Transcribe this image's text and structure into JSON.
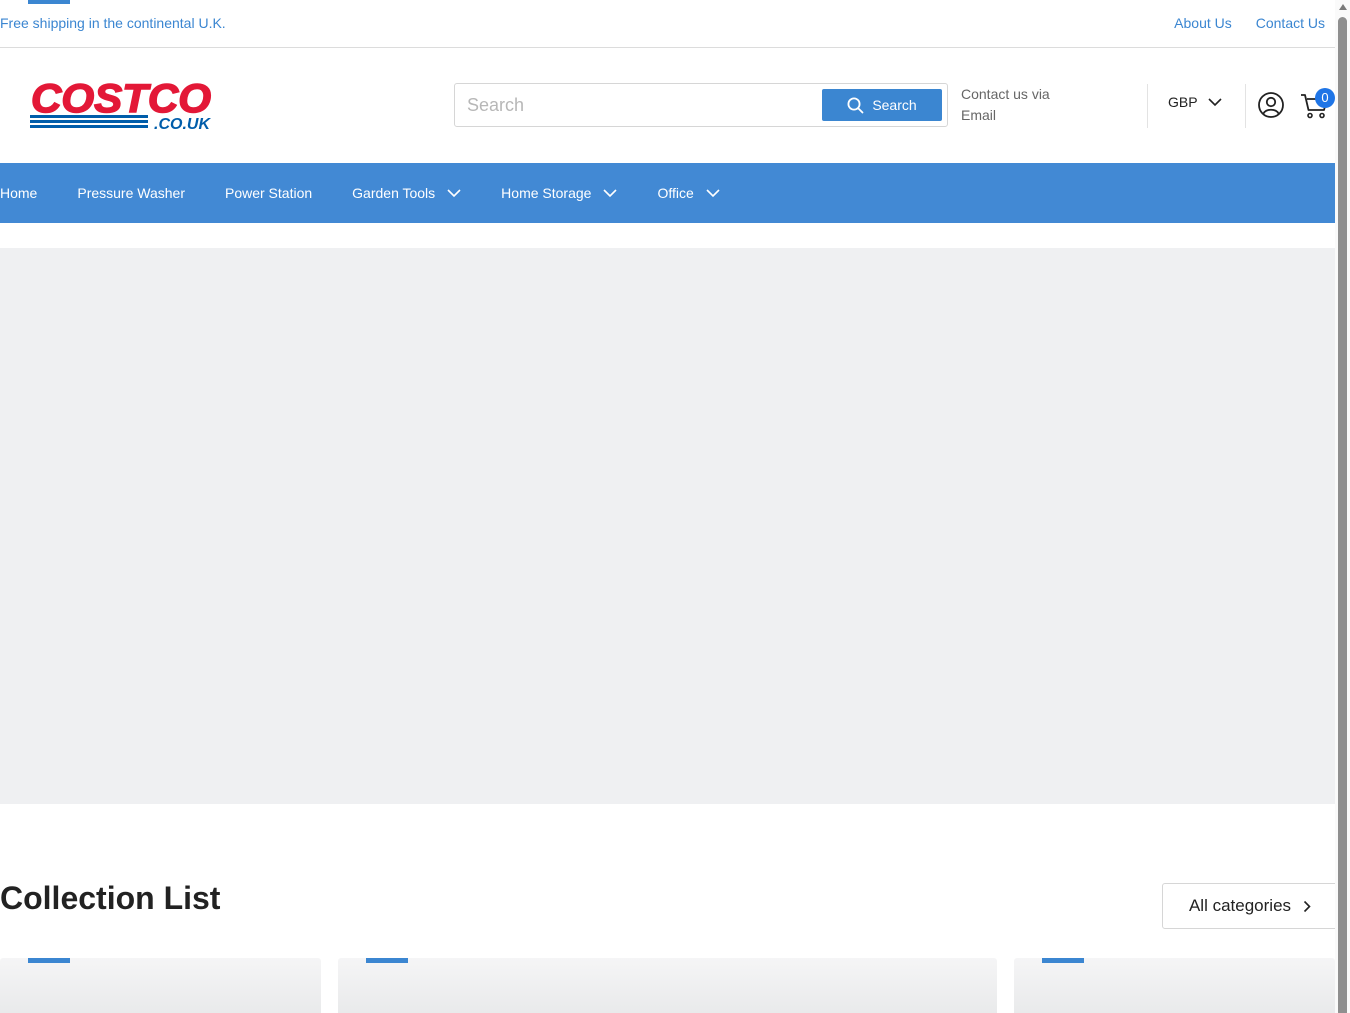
{
  "topbar": {
    "shipping_text": "Free shipping in the continental U.K.",
    "links": [
      "About Us",
      "Contact Us"
    ]
  },
  "header": {
    "logo_text": "COSTCO",
    "logo_domain": ".CO.UK",
    "search": {
      "placeholder": "Search",
      "button_label": "Search"
    },
    "contact_line1": "Contact us via",
    "contact_line2": "Email",
    "currency": "GBP",
    "cart_count": "0"
  },
  "nav": {
    "items": [
      {
        "label": "Home"
      },
      {
        "label": "Pressure Washer"
      },
      {
        "label": "Power Station"
      },
      {
        "label": "Garden Tools"
      },
      {
        "label": "Home Storage"
      },
      {
        "label": "Office"
      }
    ]
  },
  "collections": {
    "title": "Collection List",
    "all_categories_label": "All categories"
  },
  "colors": {
    "accent": "#3b86d1",
    "nav_bg": "#4289d4",
    "logo_red": "#e31837",
    "logo_blue": "#005daa",
    "badge": "#1f75e6"
  },
  "icons": [
    "search-icon",
    "chevron-down-icon",
    "user-account-icon",
    "shopping-cart-icon",
    "chevron-right-icon"
  ]
}
